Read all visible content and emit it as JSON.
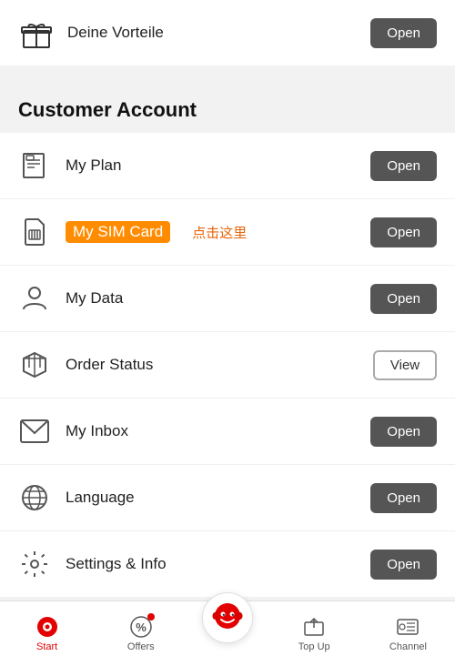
{
  "top_banner": {
    "label": "Deine Vorteile",
    "button": "Open"
  },
  "section": {
    "title": "Customer Account"
  },
  "menu_items": [
    {
      "id": "my-plan",
      "label": "My Plan",
      "button": "Open",
      "button_type": "open"
    },
    {
      "id": "my-sim-card",
      "label": "My SIM Card",
      "button": "Open",
      "button_type": "open",
      "highlight": true,
      "hint": "点击这里"
    },
    {
      "id": "my-data",
      "label": "My Data",
      "button": "Open",
      "button_type": "open"
    },
    {
      "id": "order-status",
      "label": "Order Status",
      "button": "View",
      "button_type": "view"
    },
    {
      "id": "my-inbox",
      "label": "My Inbox",
      "button": "Open",
      "button_type": "open"
    },
    {
      "id": "language",
      "label": "Language",
      "button": "Open",
      "button_type": "open"
    },
    {
      "id": "settings-info",
      "label": "Settings & Info",
      "button": "Open",
      "button_type": "open"
    }
  ],
  "bottom_nav": {
    "items": [
      {
        "id": "start",
        "label": "Start",
        "active": true
      },
      {
        "id": "offers",
        "label": "Offers",
        "badge": true
      },
      {
        "id": "home",
        "label": "",
        "center": true
      },
      {
        "id": "top-up",
        "label": "Top Up"
      },
      {
        "id": "channel",
        "label": "Channel"
      }
    ]
  }
}
